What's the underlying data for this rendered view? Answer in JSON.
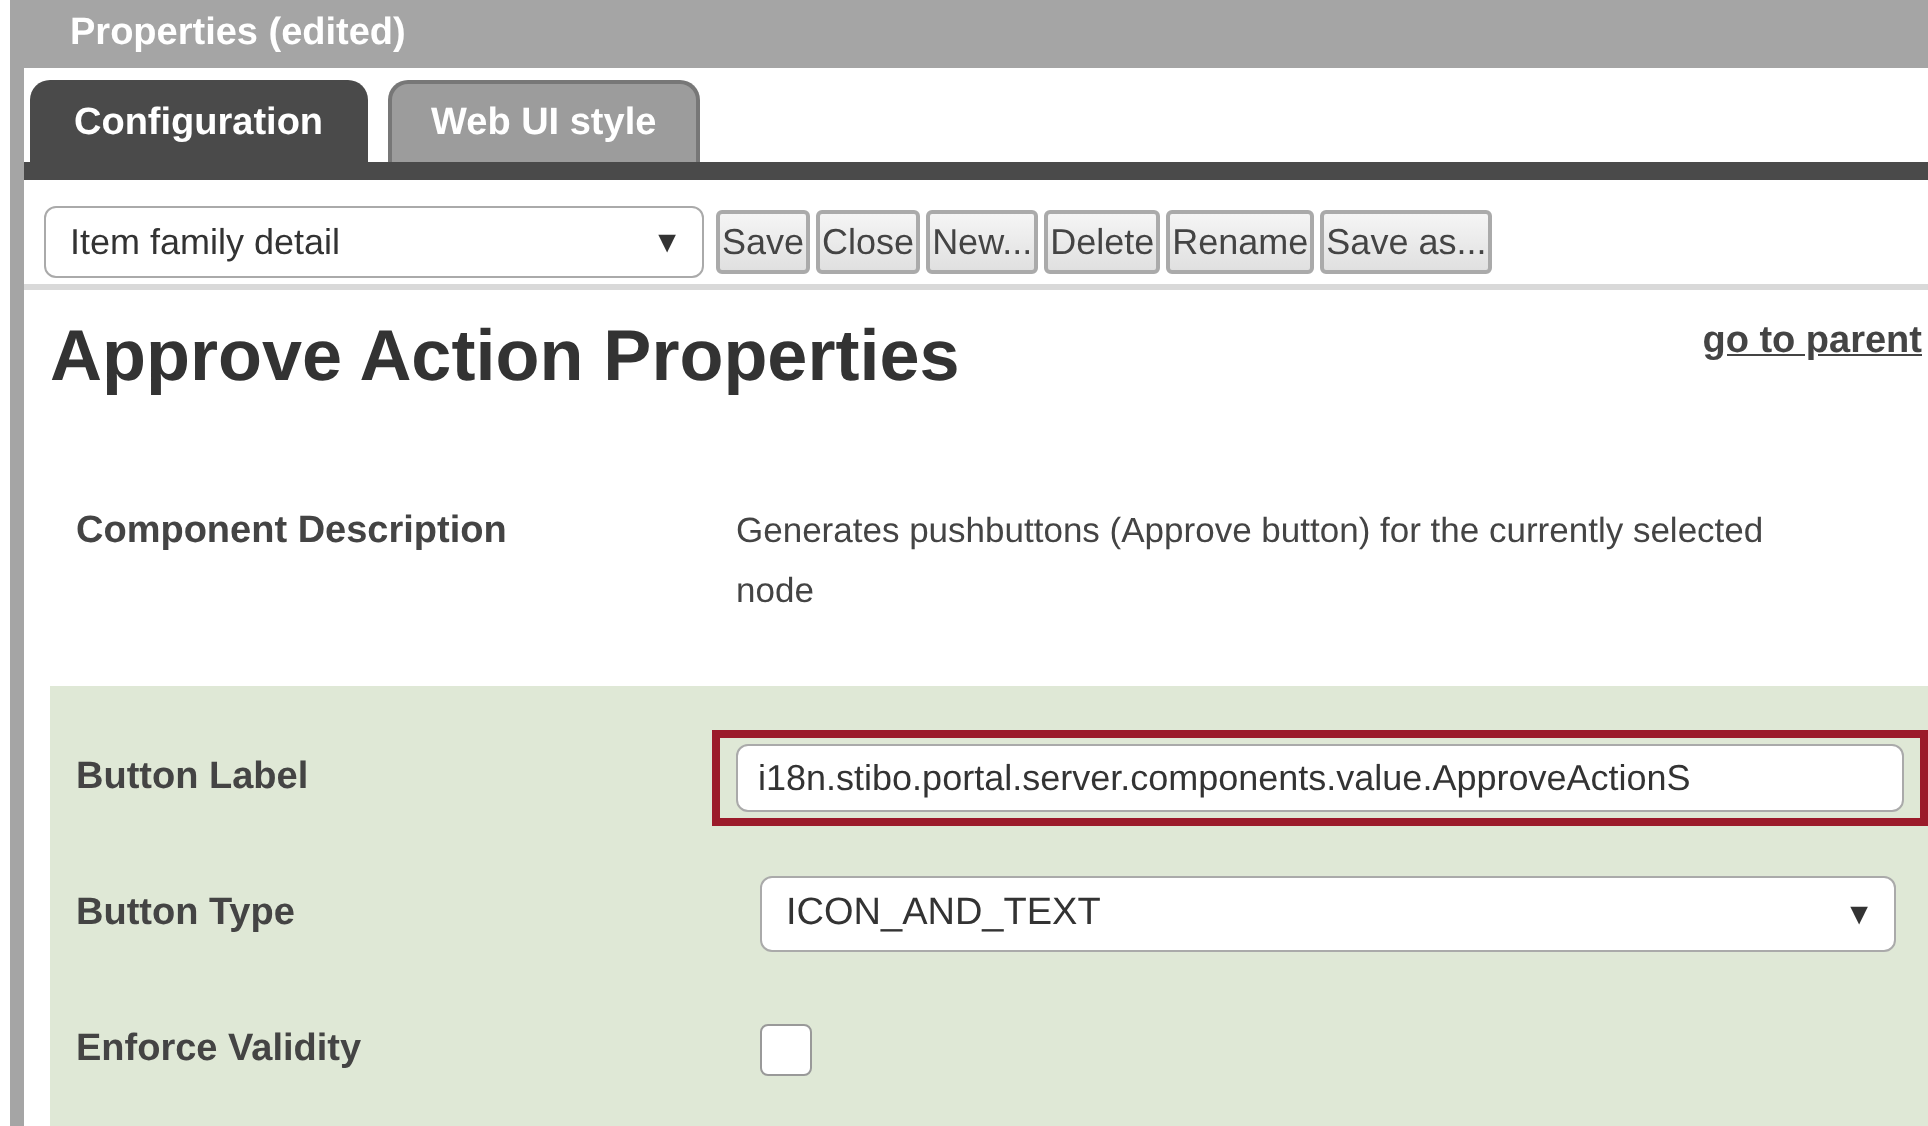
{
  "window": {
    "title": "Properties (edited)"
  },
  "tabs": [
    {
      "label": "Configuration",
      "selected": true
    },
    {
      "label": "Web UI style",
      "selected": false
    }
  ],
  "toolbar": {
    "view_select": {
      "value": "Item family detail",
      "arrow": "▼"
    },
    "buttons": [
      "Save",
      "Close",
      "New...",
      "Delete",
      "Rename",
      "Save as..."
    ]
  },
  "heading": "Approve Action Properties",
  "parent_link": "go to parent",
  "description": {
    "label": "Component Description",
    "text": "Generates pushbuttons (Approve button) for the currently selected node"
  },
  "fields": [
    {
      "kind": "text",
      "label": "Button Label",
      "value": "i18n.stibo.portal.server.components.value.ApproveActionS",
      "highlighted": true
    },
    {
      "kind": "select",
      "label": "Button Type",
      "value": "ICON_AND_TEXT",
      "arrow": "▼",
      "highlighted": false
    },
    {
      "kind": "checkbox",
      "label": "Enforce Validity",
      "checked": false,
      "highlighted": false
    }
  ]
}
